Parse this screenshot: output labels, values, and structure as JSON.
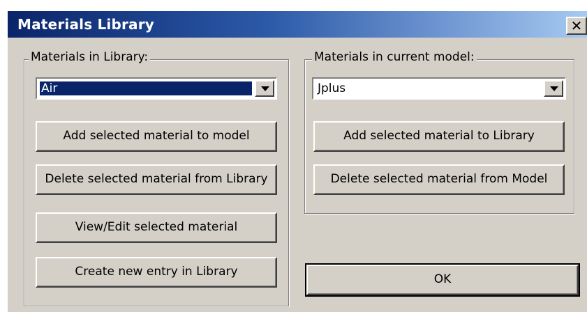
{
  "window": {
    "title": "Materials Library"
  },
  "library": {
    "group_label": "Materials in Library:",
    "selected": "Air",
    "buttons": {
      "add": "Add selected material to model",
      "delete": "Delete selected material from Library",
      "view_edit": "View/Edit selected material",
      "create": "Create new entry in Library"
    }
  },
  "model": {
    "group_label": "Materials in current model:",
    "selected": "Jplus",
    "buttons": {
      "add": "Add selected material to Library",
      "delete": "Delete selected material from Model"
    }
  },
  "ok_label": "OK",
  "close_glyph": "✕"
}
